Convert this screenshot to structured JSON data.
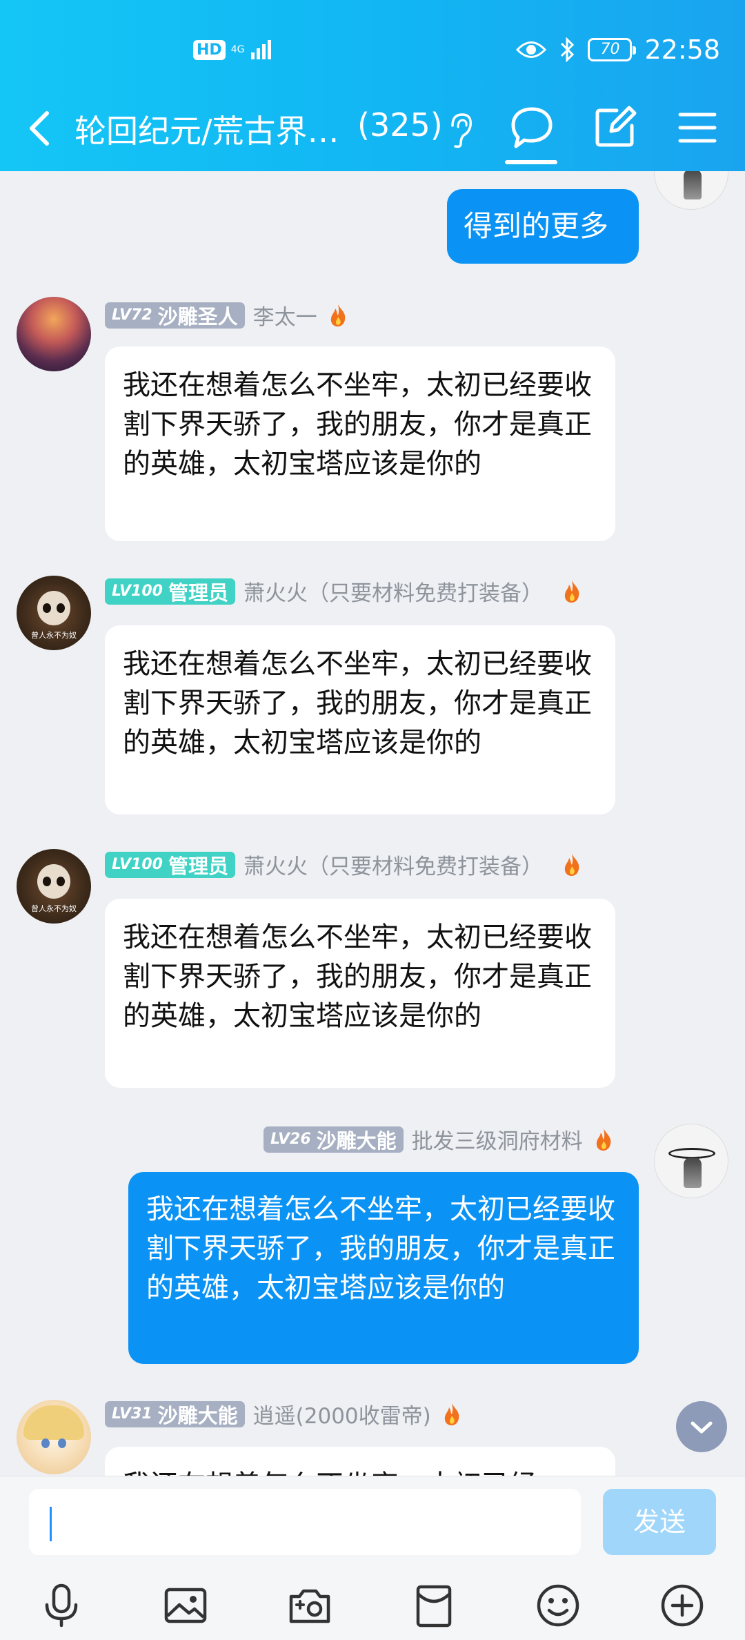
{
  "status_bar": {
    "network_hd": "HD",
    "network_4g": "4G",
    "battery": "70",
    "time": "22:58"
  },
  "header": {
    "title": "轮回纪元/荒古界…",
    "member_count": "(325)",
    "icons": [
      "back-icon",
      "ear-icon",
      "chat-bubble-icon",
      "edit-icon",
      "menu-icon"
    ]
  },
  "messages": [
    {
      "side": "right",
      "text": "得到的更多"
    },
    {
      "side": "left",
      "level": "LV72",
      "title": "沙雕圣人",
      "nick": "李太一",
      "text": "我还在想着怎么不坐牢，太初已经要收割下界天骄了，我的朋友，你才是真正的英雄，太初宝塔应该是你的"
    },
    {
      "side": "left",
      "level": "LV100",
      "title": "管理员",
      "nick": "萧火火（只要材料免费打装备）",
      "avatar_caption": "曾人永不为奴",
      "text": "我还在想着怎么不坐牢，太初已经要收割下界天骄了，我的朋友，你才是真正的英雄，太初宝塔应该是你的"
    },
    {
      "side": "left",
      "level": "LV100",
      "title": "管理员",
      "nick": "萧火火（只要材料免费打装备）",
      "avatar_caption": "曾人永不为奴",
      "text": "我还在想着怎么不坐牢，太初已经要收割下界天骄了，我的朋友，你才是真正的英雄，太初宝塔应该是你的"
    },
    {
      "side": "right",
      "level": "LV26",
      "title": "沙雕大能",
      "nick": "批发三级洞府材料",
      "text": "我还在想着怎么不坐牢，太初已经要收割下界天骄了，我的朋友，你才是真正的英雄，太初宝塔应该是你的"
    },
    {
      "side": "left",
      "level": "LV31",
      "title": "沙雕大能",
      "nick": "逍遥(2000收雷帝)",
      "text": "我还在想着怎么不坐牢，太初已经"
    }
  ],
  "input": {
    "placeholder": "",
    "send_label": "发送"
  },
  "toolbar_icons": [
    "microphone-icon",
    "image-icon",
    "camera-icon",
    "red-packet-icon",
    "emoji-icon",
    "plus-icon"
  ],
  "colors": {
    "header": "#14c6f6",
    "accent_blue": "#0a93f5",
    "send_disabled": "#9fd6fa"
  }
}
